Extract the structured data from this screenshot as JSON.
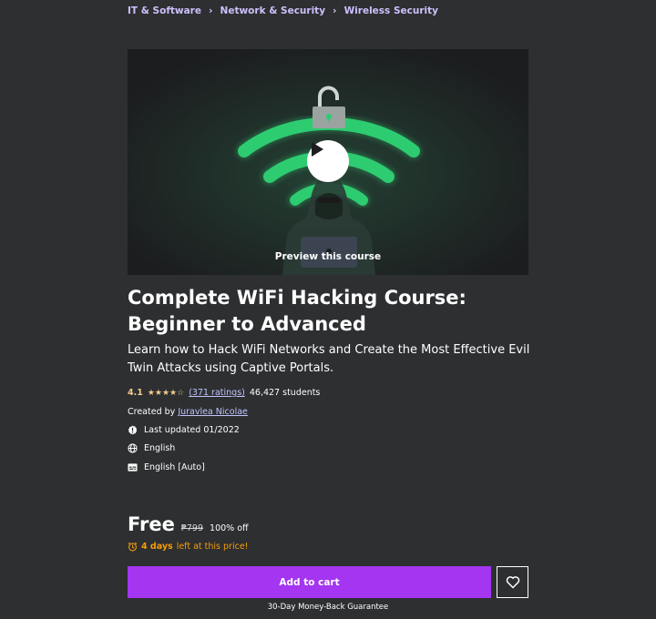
{
  "breadcrumb": {
    "items": [
      "IT & Software",
      "Network & Security",
      "Wireless Security"
    ]
  },
  "preview": {
    "label": "Preview this course"
  },
  "course": {
    "title": "Complete WiFi Hacking Course: Beginner to Advanced",
    "subtitle": "Learn how to Hack WiFi Networks and Create the Most Effective Evil Twin Attacks using Captive Portals.",
    "rating": "4.1",
    "stars": "★★★★☆",
    "ratings_count": "(371 ratings)",
    "students": "46,427 students",
    "created_by_label": "Created by",
    "author": "Juravlea Nicolae",
    "last_updated": "Last updated 01/2022",
    "language": "English",
    "captions": "English [Auto]"
  },
  "pricing": {
    "price": "Free",
    "original_price": "₱799",
    "discount": "100% off",
    "days_left": "4 days",
    "days_left_suffix": "left at this price!"
  },
  "actions": {
    "add_to_cart": "Add to cart",
    "guarantee": "30-Day Money-Back Guarantee"
  },
  "colors": {
    "background": "#2d2f31",
    "accent": "#a435f0",
    "link": "#c0c4fc",
    "rating": "#f3ca8c",
    "timer": "#f69c08",
    "wifi_green": "#2ecc71"
  }
}
